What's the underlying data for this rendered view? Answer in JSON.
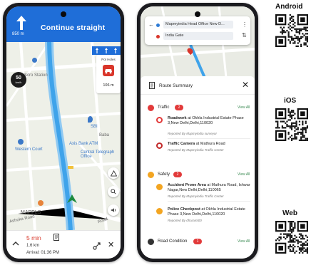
{
  "navigation": {
    "distance": "850 m",
    "instruction": "Continue straight",
    "speed_value": "50",
    "speed_unit": "km/h",
    "poi_title": "Pot Holes",
    "poi_distance": "106 m",
    "map_labels": {
      "metro": "Metro Station",
      "sbi": "SBI",
      "baba": "Baba",
      "western": "Western Court",
      "bank": "Axis Bank ATM",
      "telegraph": "Central Telegraph Office",
      "mapple": "MAPPLS",
      "ashoka": "Ashoka Road",
      "road": "Road"
    },
    "eta_time": "5 min",
    "eta_distance": "1.6 km",
    "eta_arrival": "Arrival: 01:36 PM"
  },
  "route_summary": {
    "from": "Mapmyindia Head Office New D...",
    "to": "India Gate",
    "title": "Route Summary",
    "categories": [
      {
        "name": "Traffic",
        "count": "2",
        "view_all": "View All",
        "items": [
          {
            "bold": "Roadwork",
            "text": " at Okhla Industrial Estate Phase 3,New Delhi,Delhi,110020",
            "reported": "Reported By Mapmyindia surveyor"
          },
          {
            "bold": "Traffic Camera",
            "text": " at Mathura Road",
            "reported": "Reported By Mapmyindia Traffic Center"
          }
        ]
      },
      {
        "name": "Safety",
        "count": "2",
        "view_all": "View All",
        "items": [
          {
            "bold": "Accident Prone Area",
            "text": " at Mathura Road, Ishwar Nagar,New Delhi,Delhi,110065",
            "reported": "Reported By Mapmyindia Traffic Center"
          },
          {
            "bold": "Police Checkpost",
            "text": " at Okhla Industrial Estate Phase 3,New Delhi,Delhi,110020",
            "reported": "Reported By dharamt00"
          }
        ]
      },
      {
        "name": "Road Condition",
        "count": "1",
        "view_all": "View All",
        "items": []
      }
    ]
  },
  "downloads": {
    "android": "Android",
    "ios": "iOS",
    "web": "Web"
  },
  "colors": {
    "nav_blue": "#1f6ed8",
    "alert_red": "#e23a3a",
    "eta_red": "#d8392b",
    "safety_orange": "#f3a521",
    "link_green": "#3a8a52"
  }
}
